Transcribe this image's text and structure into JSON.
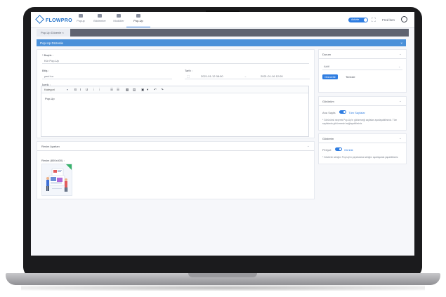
{
  "app": {
    "logo": "FLOWPRO",
    "nav": [
      {
        "label": "Popup",
        "icon": "home-icon"
      },
      {
        "label": "Bildirimler",
        "icon": "flag-icon"
      },
      {
        "label": "Modüller",
        "icon": "grid-icon"
      },
      {
        "label": "Pop-Up",
        "icon": "popup-icon"
      }
    ],
    "toggle_label": "Aktivite",
    "user_name": "Fred ben"
  },
  "tabs": [
    {
      "label": "Pop-Up Düzenle"
    }
  ],
  "header": {
    "title": "Pop-Up Düzenle",
    "close": "×"
  },
  "form": {
    "title_label": "* Başlık :",
    "title_value": "Kür Pop-Up",
    "start_label": "Bitiş :",
    "start_value": "yeni tur",
    "date_label": "Tarih :",
    "date_start": "2021-01-12 08:00",
    "date_end": "2021-01-16 12:00",
    "content_label": "İçerik :",
    "editor_style": "Kategori",
    "editor_text": "Pop-Up",
    "toolbar": [
      "B",
      "I",
      "U",
      "⋮",
      "⋮",
      "☰",
      "☰",
      "▦",
      "▤",
      "▣",
      "▾",
      "↶",
      "↷"
    ]
  },
  "extra": {
    "title": "Resim Ayarları",
    "image_label": "Resim (800x400) :"
  },
  "durum": {
    "title": "Durum",
    "select_value": "Aktif",
    "update_button": "Güncelle",
    "clear_button": "Temizle"
  },
  "gorunum": {
    "title": "Görünüm",
    "toggle_prefix": "Ana Sayfa",
    "toggle_label": "Tüm Sayfalar",
    "note": "* Görünümü seçerek Pop-Up'ın görüneceği sayfaları ayarlayabilirsiniz. Tüm sayfalarda görünmesini sağlayabilirsiniz."
  },
  "gosterim": {
    "title": "Gösterim",
    "toggle_prefix": "Periyot",
    "toggle_label": "Günlük",
    "note": "* Gösterim sıklığını Pop-Up'ın yayınlanma sıklığını ayarlayarak yapabilirsiniz."
  },
  "colors": {
    "accent": "#2f7de1",
    "header": "#4a90d9"
  }
}
